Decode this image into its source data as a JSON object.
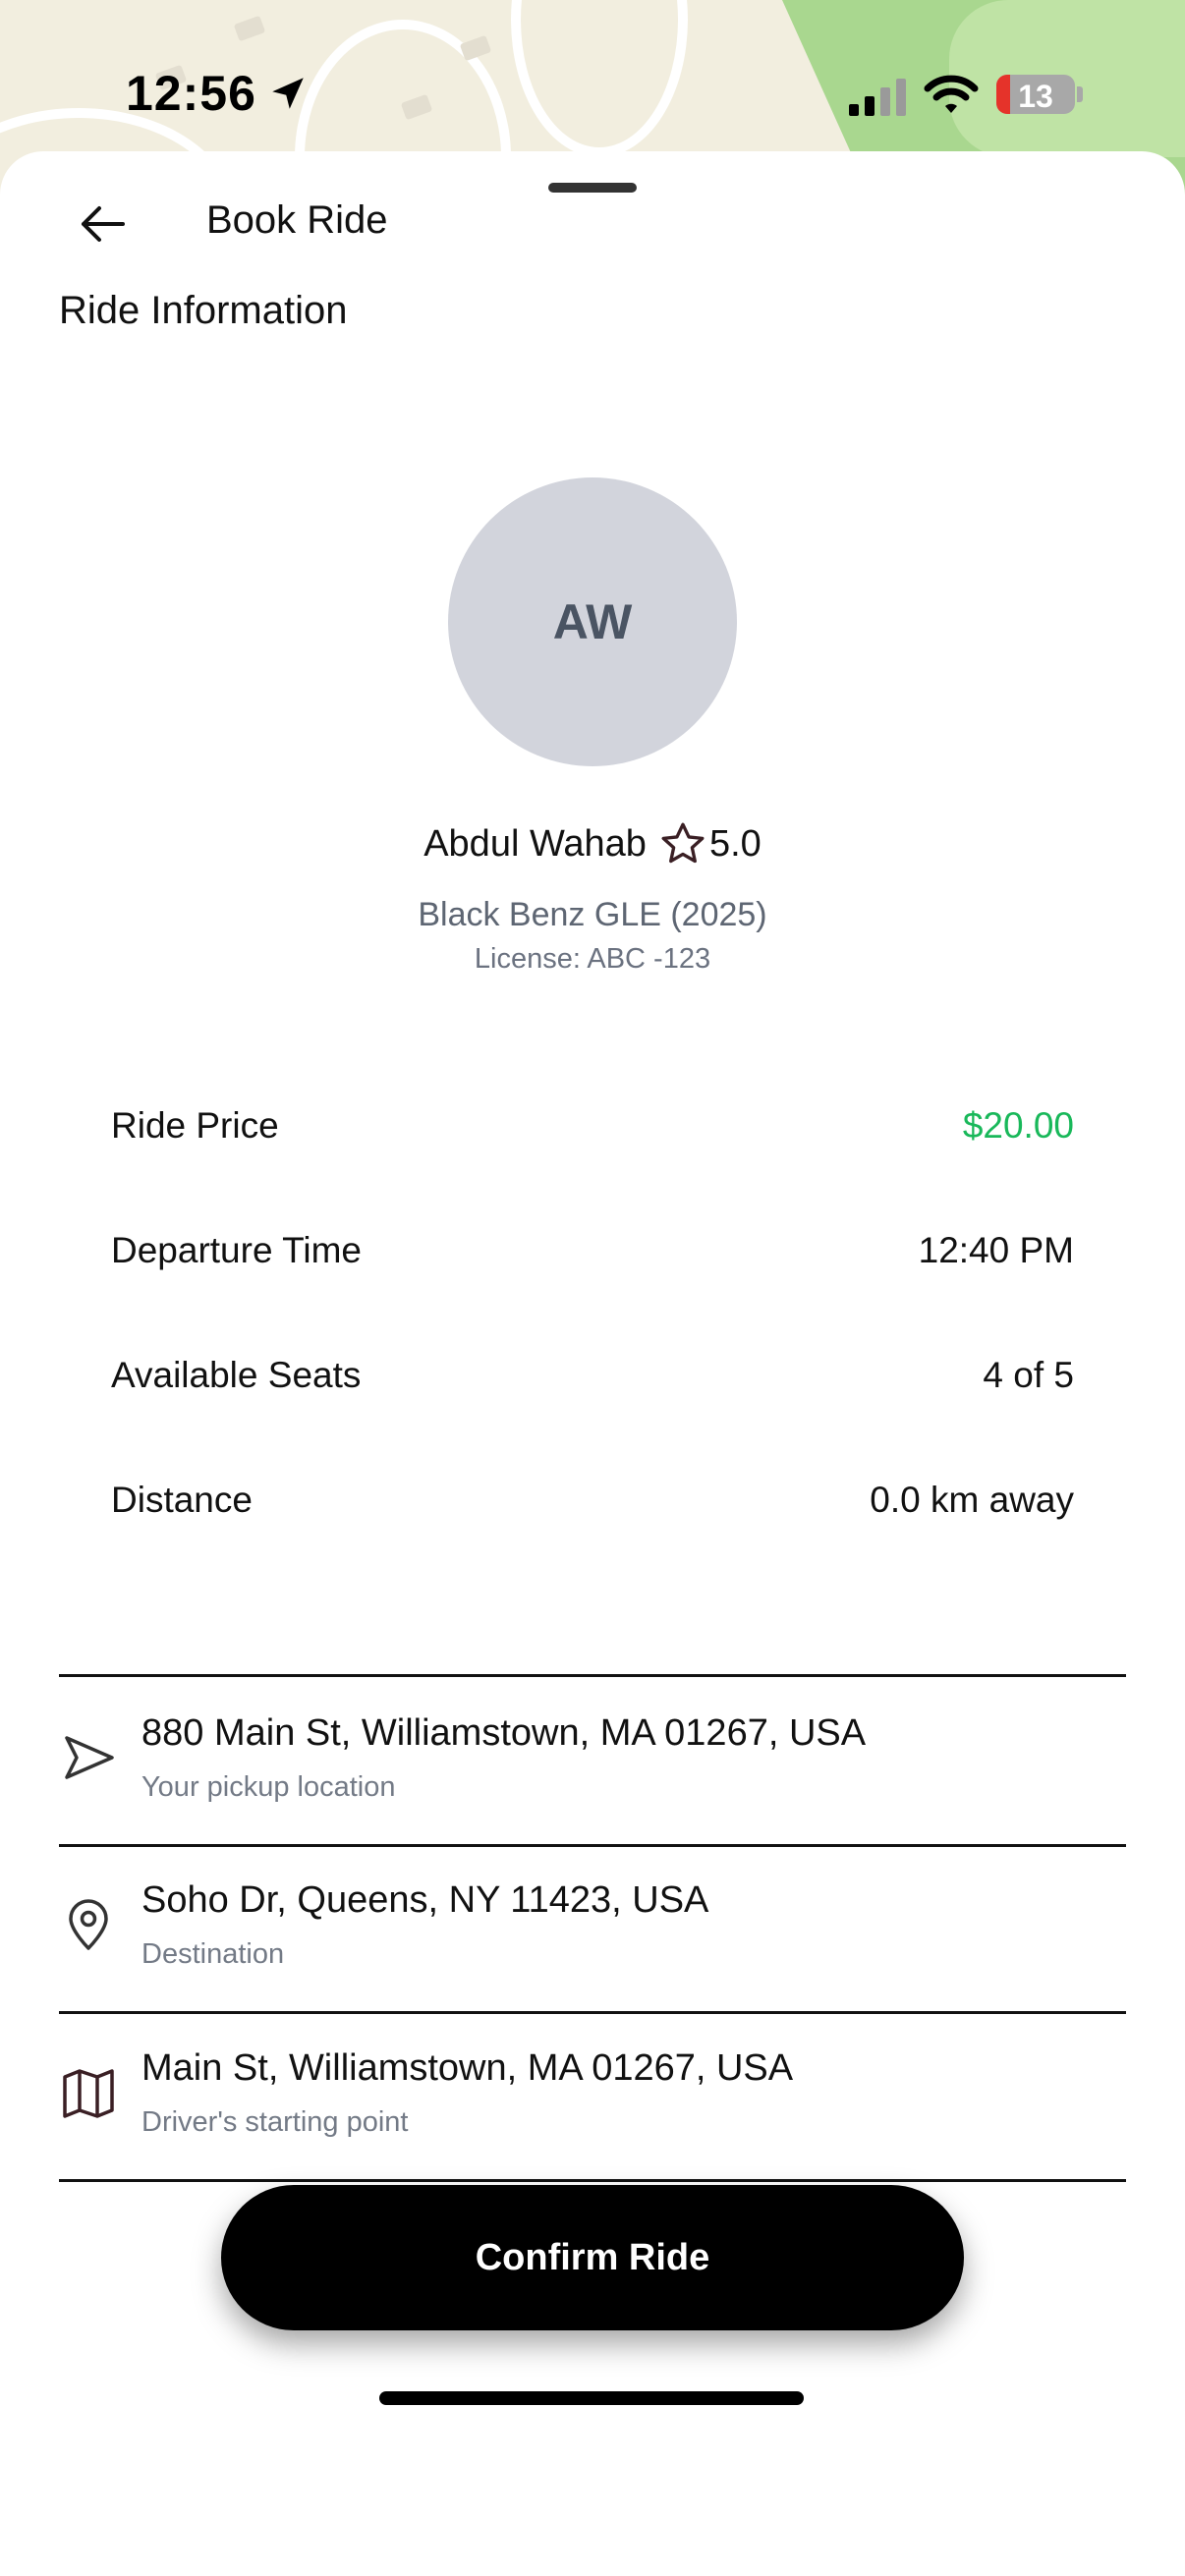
{
  "status_bar": {
    "time": "12:56",
    "battery_level": "13"
  },
  "header": {
    "title": "Book Ride"
  },
  "section": {
    "title": "Ride Information"
  },
  "driver": {
    "initials": "AW",
    "name": "Abdul Wahab",
    "rating": "5.0",
    "vehicle": "Black Benz GLE (2025)",
    "license": "License: ABC -123"
  },
  "ride_info": [
    {
      "label": "Ride Price",
      "value": "$20.00"
    },
    {
      "label": "Departure Time",
      "value": "12:40 PM"
    },
    {
      "label": "Available Seats",
      "value": "4 of 5"
    },
    {
      "label": "Distance",
      "value": "0.0 km away"
    }
  ],
  "locations": [
    {
      "icon": "navigation-arrow-icon",
      "address": "880 Main St, Williamstown, MA 01267, USA",
      "description": "Your pickup location"
    },
    {
      "icon": "map-pin-icon",
      "address": "Soho Dr, Queens, NY 11423, USA",
      "description": "Destination"
    },
    {
      "icon": "map-icon",
      "address": "Main St, Williamstown, MA 01267, USA",
      "description": "Driver's starting point"
    }
  ],
  "actions": {
    "confirm_label": "Confirm Ride"
  },
  "colors": {
    "price": "#19b85a",
    "button_bg": "#000000",
    "avatar_bg": "#d2d4dc"
  }
}
